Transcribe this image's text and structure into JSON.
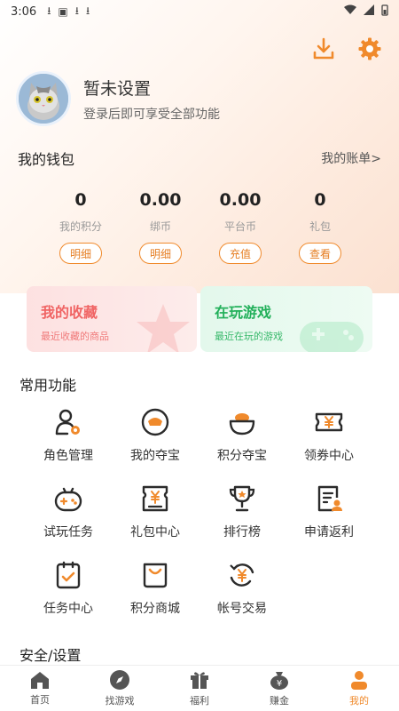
{
  "status_bar": {
    "time": "3:06"
  },
  "profile": {
    "name": "暂未设置",
    "subtitle": "登录后即可享受全部功能"
  },
  "wallet": {
    "title": "我的钱包",
    "bill_link": "我的账单>",
    "items": [
      {
        "value": "0",
        "label": "我的积分",
        "button": "明细"
      },
      {
        "value": "0.00",
        "label": "绑币",
        "button": "明细"
      },
      {
        "value": "0.00",
        "label": "平台币",
        "button": "充值"
      },
      {
        "value": "0",
        "label": "礼包",
        "button": "查看"
      }
    ]
  },
  "cards": {
    "favorites": {
      "title": "我的收藏",
      "subtitle": "最近收藏的商品"
    },
    "playing": {
      "title": "在玩游戏",
      "subtitle": "最近在玩的游戏"
    }
  },
  "common": {
    "title": "常用功能",
    "items": [
      {
        "label": "角色管理",
        "icon": "role-icon"
      },
      {
        "label": "我的夺宝",
        "icon": "treasure-icon"
      },
      {
        "label": "积分夺宝",
        "icon": "gold-bowl-icon"
      },
      {
        "label": "领券中心",
        "icon": "coupon-icon"
      },
      {
        "label": "试玩任务",
        "icon": "gamepad-icon"
      },
      {
        "label": "礼包中心",
        "icon": "gift-bag-icon"
      },
      {
        "label": "排行榜",
        "icon": "trophy-icon"
      },
      {
        "label": "申请返利",
        "icon": "rebate-icon"
      },
      {
        "label": "任务中心",
        "icon": "task-icon"
      },
      {
        "label": "积分商城",
        "icon": "shop-icon"
      },
      {
        "label": "帐号交易",
        "icon": "trade-icon"
      }
    ]
  },
  "security": {
    "title": "安全/设置"
  },
  "tabbar": {
    "items": [
      {
        "label": "首页",
        "icon": "home-icon"
      },
      {
        "label": "找游戏",
        "icon": "compass-icon"
      },
      {
        "label": "福利",
        "icon": "gift-icon"
      },
      {
        "label": "赚金",
        "icon": "money-bag-icon"
      },
      {
        "label": "我的",
        "icon": "user-icon"
      }
    ],
    "active_index": 4
  },
  "colors": {
    "accent": "#f08a2c",
    "fav_red": "#f06464",
    "play_green": "#22b05a",
    "icon_dark": "#2b2b2b"
  }
}
